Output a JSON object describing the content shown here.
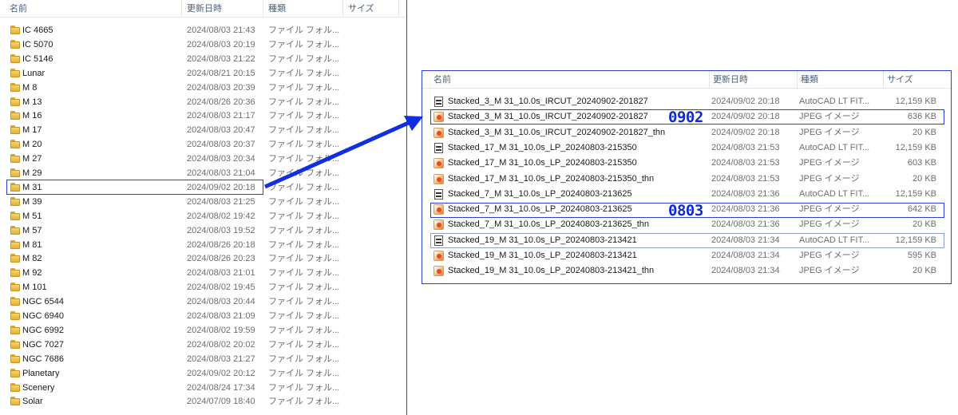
{
  "left": {
    "headers": {
      "name": "名前",
      "date": "更新日時",
      "type": "種類",
      "size": "サイズ"
    },
    "rows": [
      {
        "name": "IC 4665",
        "date": "2024/08/03 21:43",
        "type": "ファイル フォル..."
      },
      {
        "name": "IC 5070",
        "date": "2024/08/03 20:19",
        "type": "ファイル フォル..."
      },
      {
        "name": "IC 5146",
        "date": "2024/08/03 21:22",
        "type": "ファイル フォル..."
      },
      {
        "name": "Lunar",
        "date": "2024/08/21 20:15",
        "type": "ファイル フォル..."
      },
      {
        "name": "M 8",
        "date": "2024/08/03 20:39",
        "type": "ファイル フォル..."
      },
      {
        "name": "M 13",
        "date": "2024/08/26 20:36",
        "type": "ファイル フォル..."
      },
      {
        "name": "M 16",
        "date": "2024/08/03 21:17",
        "type": "ファイル フォル..."
      },
      {
        "name": "M 17",
        "date": "2024/08/03 20:47",
        "type": "ファイル フォル..."
      },
      {
        "name": "M 20",
        "date": "2024/08/03 20:37",
        "type": "ファイル フォル..."
      },
      {
        "name": "M 27",
        "date": "2024/08/03 20:34",
        "type": "ファイル フォル..."
      },
      {
        "name": "M 29",
        "date": "2024/08/03 21:04",
        "type": "ファイル フォル..."
      },
      {
        "name": "M 31",
        "date": "2024/09/02 20:18",
        "type": "ファイル フォル..."
      },
      {
        "name": "M 39",
        "date": "2024/08/03 21:25",
        "type": "ファイル フォル..."
      },
      {
        "name": "M 51",
        "date": "2024/08/02 19:42",
        "type": "ファイル フォル..."
      },
      {
        "name": "M 57",
        "date": "2024/08/03 19:52",
        "type": "ファイル フォル..."
      },
      {
        "name": "M 81",
        "date": "2024/08/26 20:18",
        "type": "ファイル フォル..."
      },
      {
        "name": "M 82",
        "date": "2024/08/26 20:23",
        "type": "ファイル フォル..."
      },
      {
        "name": "M 92",
        "date": "2024/08/03 21:01",
        "type": "ファイル フォル..."
      },
      {
        "name": "M 101",
        "date": "2024/08/02 19:45",
        "type": "ファイル フォル..."
      },
      {
        "name": "NGC 6544",
        "date": "2024/08/03 20:44",
        "type": "ファイル フォル..."
      },
      {
        "name": "NGC 6940",
        "date": "2024/08/03 21:09",
        "type": "ファイル フォル..."
      },
      {
        "name": "NGC 6992",
        "date": "2024/08/02 19:59",
        "type": "ファイル フォル..."
      },
      {
        "name": "NGC 7027",
        "date": "2024/08/02 20:02",
        "type": "ファイル フォル..."
      },
      {
        "name": "NGC 7686",
        "date": "2024/08/03 21:27",
        "type": "ファイル フォル..."
      },
      {
        "name": "Planetary",
        "date": "2024/09/02 20:12",
        "type": "ファイル フォル..."
      },
      {
        "name": "Scenery",
        "date": "2024/08/24 17:34",
        "type": "ファイル フォル..."
      },
      {
        "name": "Solar",
        "date": "2024/07/09 18:40",
        "type": "ファイル フォル..."
      }
    ]
  },
  "right": {
    "headers": {
      "name": "名前",
      "date": "更新日時",
      "type": "種類",
      "size": "サイズ"
    },
    "rows": [
      {
        "name": "Stacked_3_M 31_10.0s_IRCUT_20240902-201827",
        "date": "2024/09/02 20:18",
        "type": "AutoCAD LT FIT...",
        "size": "12,159 KB",
        "icon": "fits-file-icon"
      },
      {
        "name": "Stacked_3_M 31_10.0s_IRCUT_20240902-201827",
        "date": "2024/09/02 20:18",
        "type": "JPEG イメージ",
        "size": "636 KB",
        "icon": "jpeg-image-icon"
      },
      {
        "name": "Stacked_3_M 31_10.0s_IRCUT_20240902-201827_thn",
        "date": "2024/09/02 20:18",
        "type": "JPEG イメージ",
        "size": "20 KB",
        "icon": "jpeg-image-icon"
      },
      {
        "name": "Stacked_17_M 31_10.0s_LP_20240803-215350",
        "date": "2024/08/03 21:53",
        "type": "AutoCAD LT FIT...",
        "size": "12,159 KB",
        "icon": "fits-file-icon"
      },
      {
        "name": "Stacked_17_M 31_10.0s_LP_20240803-215350",
        "date": "2024/08/03 21:53",
        "type": "JPEG イメージ",
        "size": "603 KB",
        "icon": "jpeg-image-icon"
      },
      {
        "name": "Stacked_17_M 31_10.0s_LP_20240803-215350_thn",
        "date": "2024/08/03 21:53",
        "type": "JPEG イメージ",
        "size": "20 KB",
        "icon": "jpeg-image-icon"
      },
      {
        "name": "Stacked_7_M 31_10.0s_LP_20240803-213625",
        "date": "2024/08/03 21:36",
        "type": "AutoCAD LT FIT...",
        "size": "12,159 KB",
        "icon": "fits-file-icon"
      },
      {
        "name": "Stacked_7_M 31_10.0s_LP_20240803-213625",
        "date": "2024/08/03 21:36",
        "type": "JPEG イメージ",
        "size": "642 KB",
        "icon": "jpeg-image-icon"
      },
      {
        "name": "Stacked_7_M 31_10.0s_LP_20240803-213625_thn",
        "date": "2024/08/03 21:36",
        "type": "JPEG イメージ",
        "size": "20 KB",
        "icon": "jpeg-image-icon"
      },
      {
        "name": "Stacked_19_M 31_10.0s_LP_20240803-213421",
        "date": "2024/08/03 21:34",
        "type": "AutoCAD LT FIT...",
        "size": "12,159 KB",
        "icon": "fits-file-icon"
      },
      {
        "name": "Stacked_19_M 31_10.0s_LP_20240803-213421",
        "date": "2024/08/03 21:34",
        "type": "JPEG イメージ",
        "size": "595 KB",
        "icon": "jpeg-image-icon"
      },
      {
        "name": "Stacked_19_M 31_10.0s_LP_20240803-213421_thn",
        "date": "2024/08/03 21:34",
        "type": "JPEG イメージ",
        "size": "20 KB",
        "icon": "jpeg-image-icon"
      }
    ]
  },
  "annotations": {
    "first": "0902",
    "second": "0803"
  },
  "colors": {
    "accent": "#2a3fd6",
    "annotation": "#0c2bd6",
    "arrow": "#1030e0"
  }
}
